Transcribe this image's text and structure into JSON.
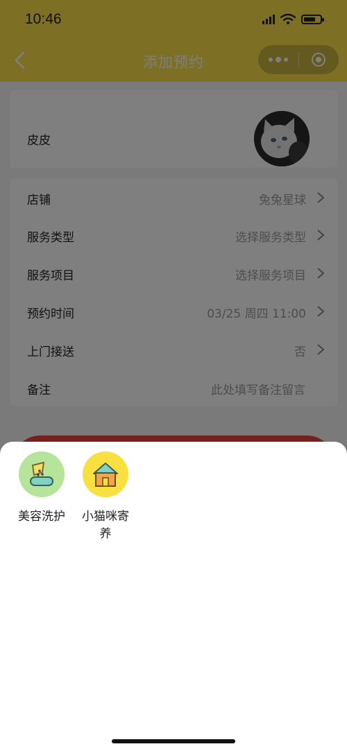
{
  "status_bar": {
    "time": "10:46"
  },
  "nav": {
    "title": "添加预约"
  },
  "pet": {
    "name": "皮皮"
  },
  "form": {
    "rows": [
      {
        "label": "店铺",
        "value": "兔兔星球"
      },
      {
        "label": "服务类型",
        "value": "选择服务类型"
      },
      {
        "label": "服务项目",
        "value": "选择服务项目"
      },
      {
        "label": "预约时间",
        "value": "03/25 周四 11:00"
      },
      {
        "label": "上门接送",
        "value": "否"
      },
      {
        "label": "备注",
        "placeholder": "此处填写备注留言"
      }
    ]
  },
  "sheet": {
    "services": [
      {
        "name": "美容洗护",
        "icon": "grooming-icon",
        "color": "#b6e49a"
      },
      {
        "name": "小猫咪寄养",
        "icon": "pet-house-icon",
        "color": "#f7e03f"
      }
    ]
  },
  "colors": {
    "brand_yellow": "#fbe04a",
    "submit_red": "#e8423f"
  }
}
